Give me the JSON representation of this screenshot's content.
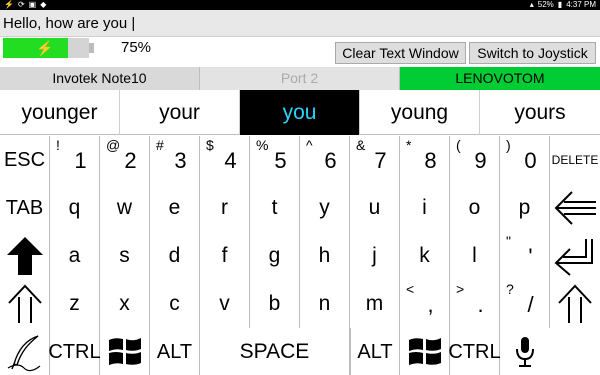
{
  "status_bar": {
    "left_icons": [
      "usb-icon",
      "sync-icon",
      "image-icon",
      "notification-icon"
    ],
    "battery_percent": "52%",
    "time": "4:37 PM"
  },
  "text_window": {
    "value": "Hello, how are you |"
  },
  "battery": {
    "percent_label": "75%",
    "level": 0.75
  },
  "buttons": {
    "clear_text": "Clear Text Window",
    "switch_joystick": "Switch to Joystick"
  },
  "ports": [
    {
      "label": "Invotek Note10",
      "state": "normal"
    },
    {
      "label": "Port 2",
      "state": "inactive"
    },
    {
      "label": "LENOVOTOM",
      "state": "active"
    }
  ],
  "suggestions": [
    "younger",
    "your",
    "you",
    "young",
    "yours"
  ],
  "selected_suggestion": "you",
  "keyboard": {
    "row1": {
      "esc": "ESC",
      "keys": [
        {
          "sub": "!",
          "main": "1"
        },
        {
          "sub": "@",
          "main": "2"
        },
        {
          "sub": "#",
          "main": "3"
        },
        {
          "sub": "$",
          "main": "4"
        },
        {
          "sub": "%",
          "main": "5"
        },
        {
          "sub": "^",
          "main": "6"
        },
        {
          "sub": "&",
          "main": "7"
        },
        {
          "sub": "*",
          "main": "8"
        },
        {
          "sub": "(",
          "main": "9"
        },
        {
          "sub": ")",
          "main": "0"
        }
      ],
      "delete": "DELETE"
    },
    "row2": {
      "tab": "TAB",
      "keys": [
        "q",
        "w",
        "e",
        "r",
        "t",
        "y",
        "u",
        "i",
        "o",
        "p"
      ]
    },
    "row3": {
      "keys": [
        "a",
        "s",
        "d",
        "f",
        "g",
        "h",
        "j",
        "k",
        "l"
      ],
      "quote": {
        "sub": "\"",
        "main": "'"
      }
    },
    "row4": {
      "keys": [
        "z",
        "x",
        "c",
        "v",
        "b",
        "n",
        "m"
      ],
      "punct": [
        {
          "sub": "<",
          "main": ","
        },
        {
          "sub": ">",
          "main": "."
        },
        {
          "sub": "?",
          "main": "/"
        }
      ]
    },
    "row5": {
      "ctrl": "CTRL",
      "alt": "ALT",
      "space": "SPACE",
      "alt2": "ALT",
      "ctrl2": "CTRL"
    }
  },
  "colors": {
    "battery_fill": "#22dd22",
    "active_port": "#00cc33",
    "selected_suggestion_bg": "#000000",
    "selected_suggestion_text": "#2bd3f7"
  }
}
